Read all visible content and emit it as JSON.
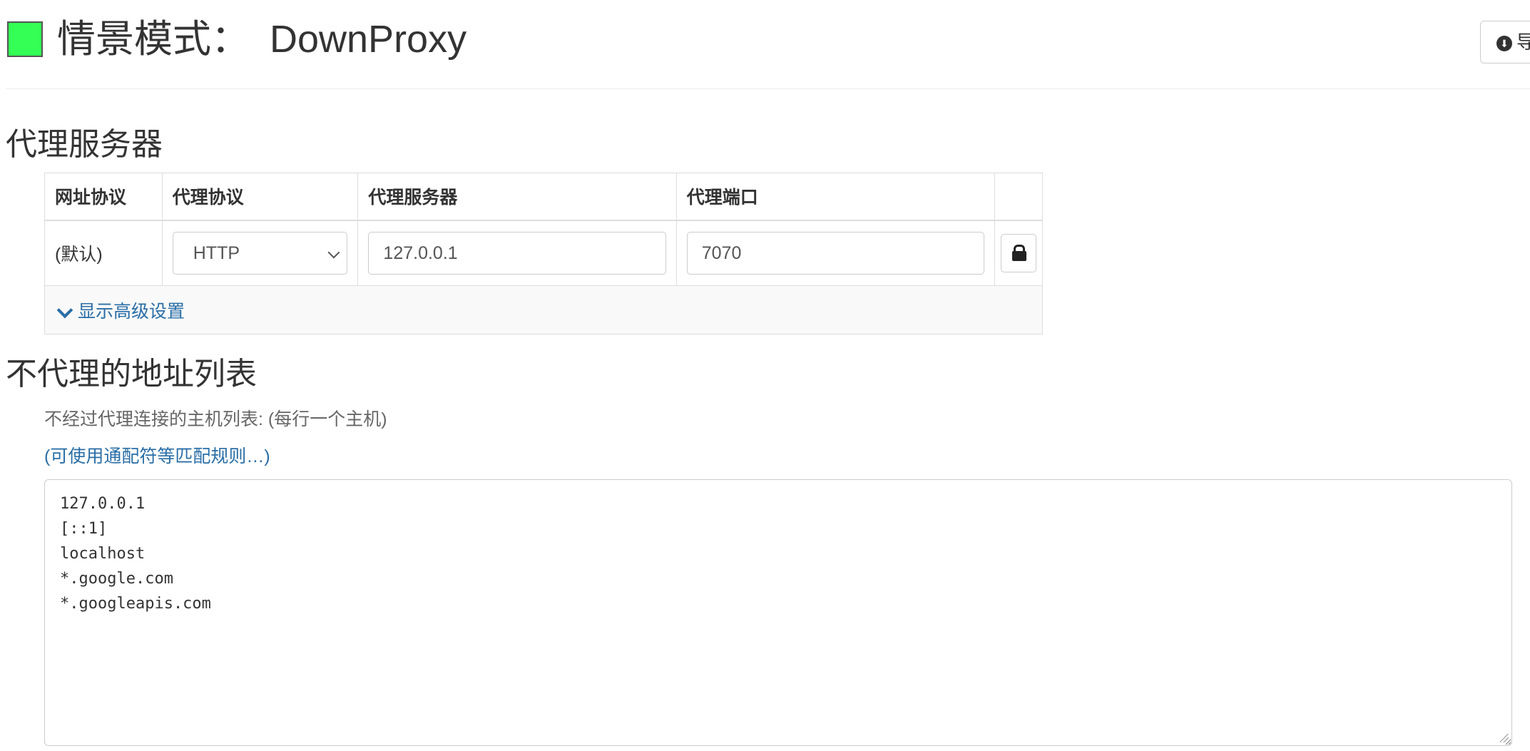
{
  "header": {
    "title_label": "情景模式：",
    "profile_name": "DownProxy",
    "profile_color": "#33ff55",
    "export_button_label": "导",
    "export_icon": "download-circle-icon"
  },
  "proxy_section": {
    "heading": "代理服务器",
    "columns": [
      "网址协议",
      "代理协议",
      "代理服务器",
      "代理端口"
    ],
    "rows": [
      {
        "scheme": "(默认)",
        "protocol": "HTTP",
        "server": "127.0.0.1",
        "port": "7070",
        "lock_icon": "lock-icon"
      }
    ],
    "advanced_link": "显示高级设置",
    "advanced_icon": "chevron-down-icon"
  },
  "bypass_section": {
    "heading": "不代理的地址列表",
    "help_text": "不经过代理连接的主机列表: (每行一个主机)",
    "wildcard_link": "(可使用通配符等匹配规则…)",
    "lines": [
      "127.0.0.1",
      "[::1]",
      "localhost",
      "*.google.com",
      "*.googleapis.com"
    ]
  },
  "colors": {
    "link": "#2a6ea6",
    "text": "#333333",
    "border": "#dddddd"
  }
}
